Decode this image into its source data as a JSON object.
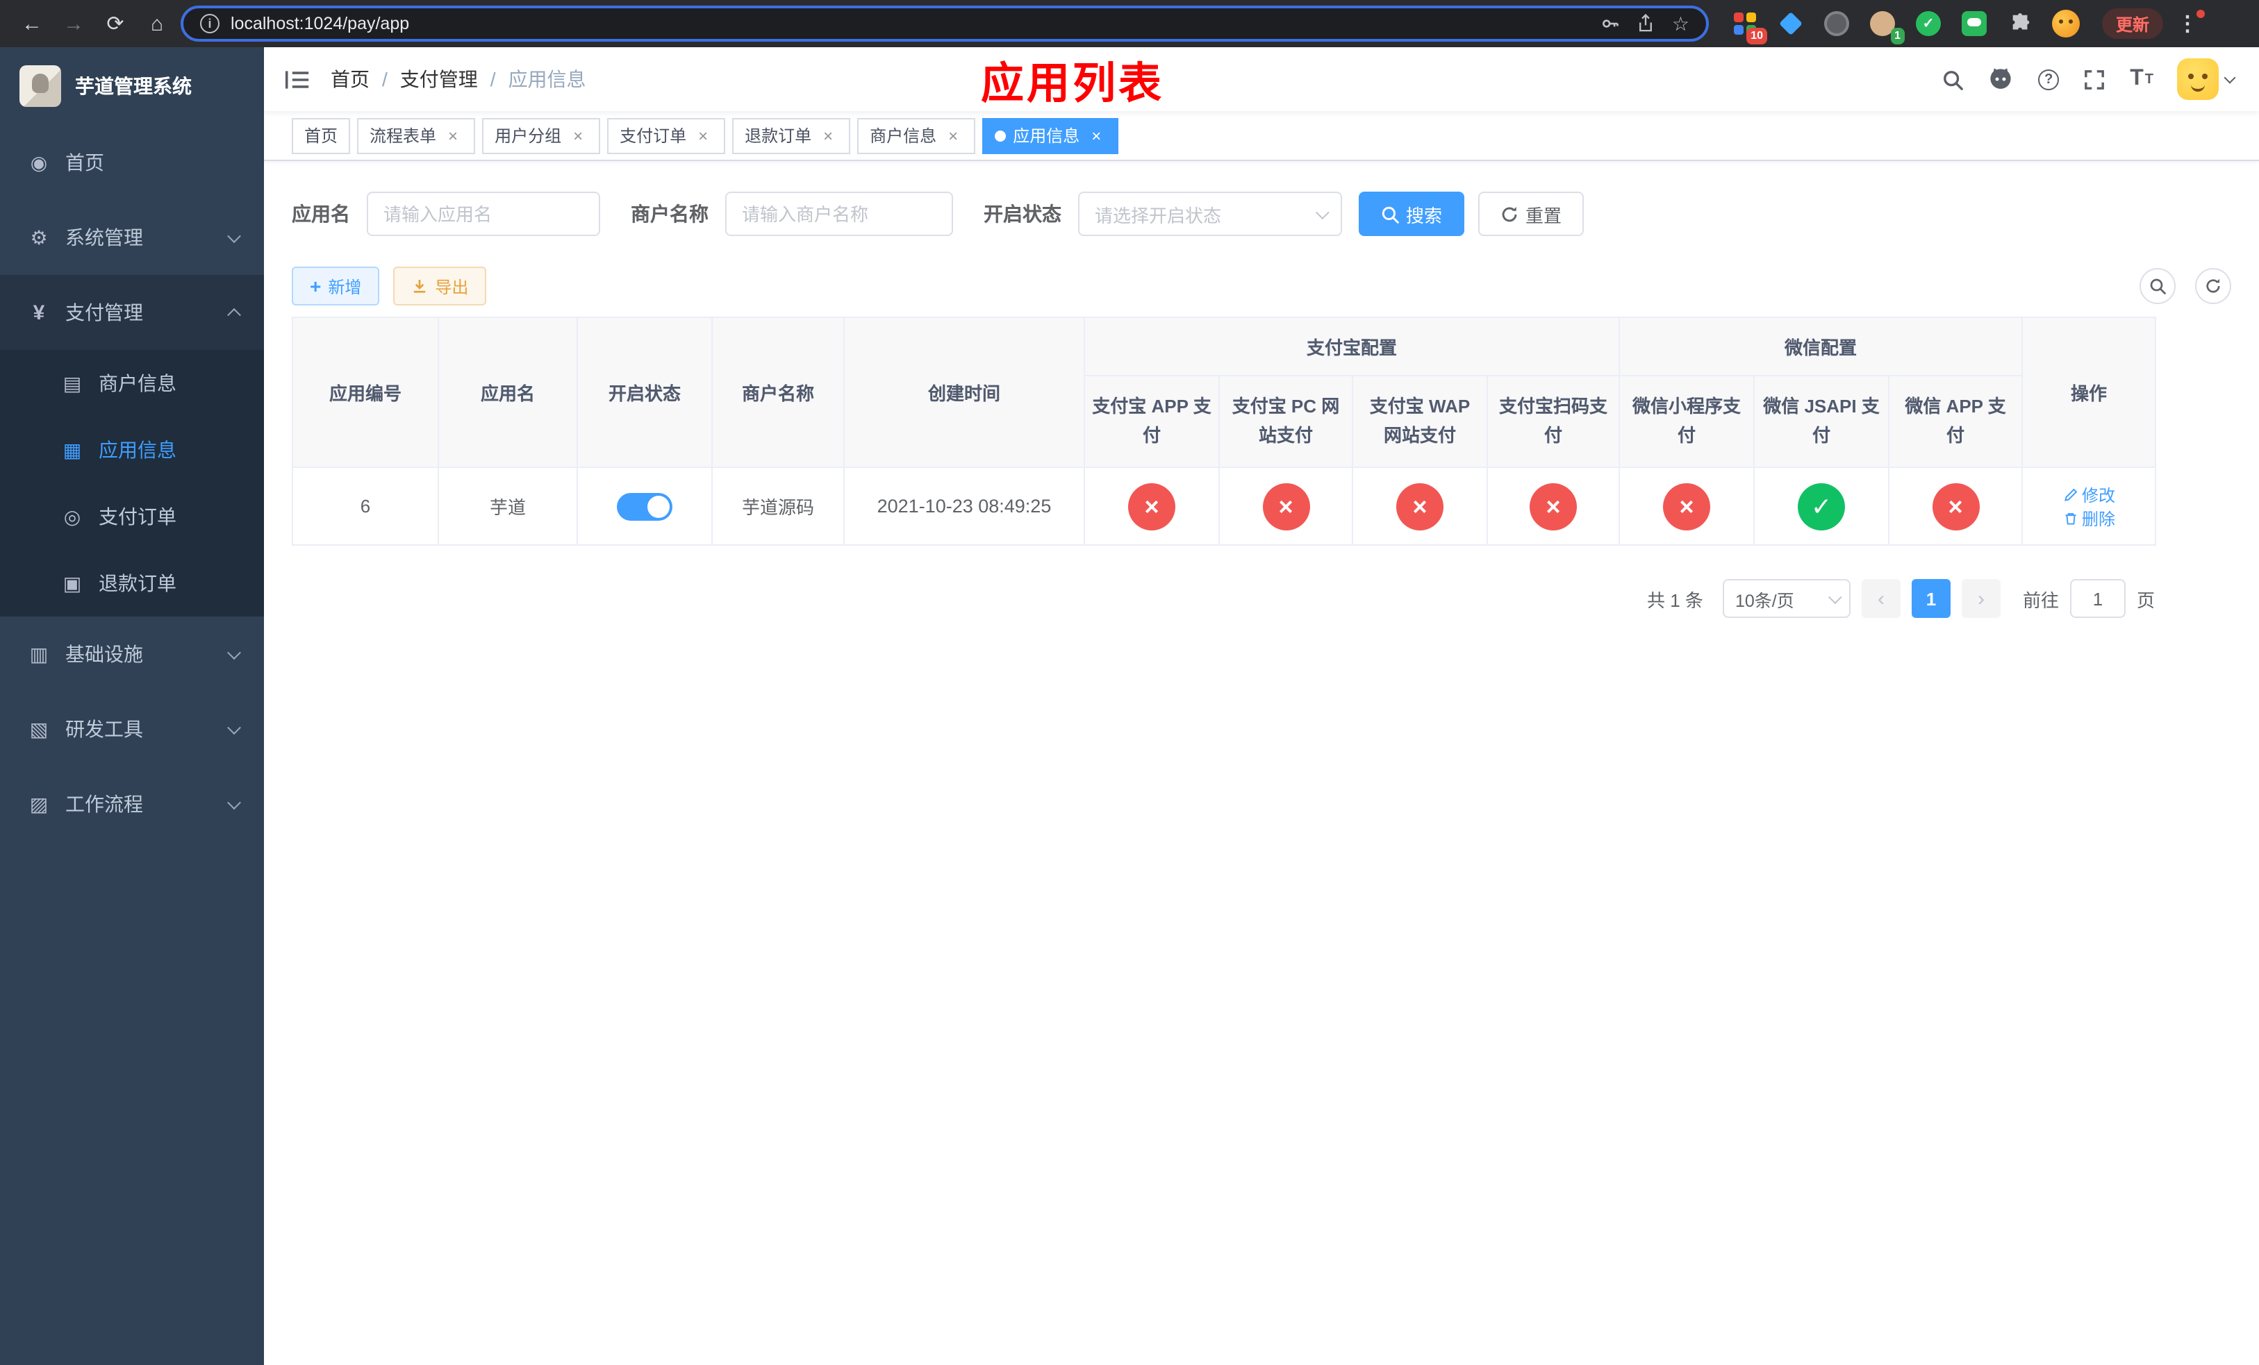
{
  "colors": {
    "primary": "#409eff",
    "success": "#12c064",
    "danger": "#f25653",
    "warning": "#e6a23c",
    "title-red": "#ff0000"
  },
  "browser": {
    "url": "localhost:1024/pay/app",
    "update_label": "更新",
    "ext_badge_blocks": "10",
    "ext_badge_avatar": "1"
  },
  "app_title": "芋道管理系统",
  "sidebar": {
    "home": "首页",
    "system": "系统管理",
    "pay": "支付管理",
    "merchant": "商户信息",
    "app_info": "应用信息",
    "pay_order": "支付订单",
    "refund_order": "退款订单",
    "infra": "基础设施",
    "dev_tools": "研发工具",
    "workflow": "工作流程"
  },
  "navbar": {
    "breadcrumb": [
      "首页",
      "支付管理",
      "应用信息"
    ],
    "page_title": "应用列表"
  },
  "tabs": [
    {
      "label": "首页"
    },
    {
      "label": "流程表单"
    },
    {
      "label": "用户分组"
    },
    {
      "label": "支付订单"
    },
    {
      "label": "退款订单"
    },
    {
      "label": "商户信息"
    },
    {
      "label": "应用信息"
    }
  ],
  "filters": {
    "app_name_label": "应用名",
    "app_name_placeholder": "请输入应用名",
    "merchant_label": "商户名称",
    "merchant_placeholder": "请输入商户名称",
    "status_label": "开启状态",
    "status_placeholder": "请选择开启状态",
    "search_button": "搜索",
    "reset_button": "重置"
  },
  "toolbar": {
    "add_button": "新增",
    "export_button": "导出"
  },
  "table": {
    "simple_columns": [
      "应用编号",
      "应用名",
      "开启状态",
      "商户名称",
      "创建时间"
    ],
    "groups": [
      {
        "label": "支付宝配置",
        "columns": [
          "支付宝 APP 支付",
          "支付宝 PC 网站支付",
          "支付宝 WAP 网站支付",
          "支付宝扫码支付"
        ]
      },
      {
        "label": "微信配置",
        "columns": [
          "微信小程序支付",
          "微信 JSAPI 支付",
          "微信 APP 支付"
        ]
      }
    ],
    "action_column": "操作",
    "rows": [
      {
        "id": "6",
        "name": "芋道",
        "enabled": true,
        "merchant": "芋道源码",
        "created": "2021-10-23 08:49:25",
        "alipay_app": false,
        "alipay_pc": false,
        "alipay_wap": false,
        "alipay_qr": false,
        "wechat_mini": false,
        "wechat_jsapi": true,
        "wechat_app": false,
        "edit_label": "修改",
        "delete_label": "删除"
      }
    ]
  },
  "pagination": {
    "total": "共 1 条",
    "page_size": "10条/页",
    "page": "1",
    "goto_label": "前往",
    "goto_value": "1",
    "unit_label": "页"
  }
}
